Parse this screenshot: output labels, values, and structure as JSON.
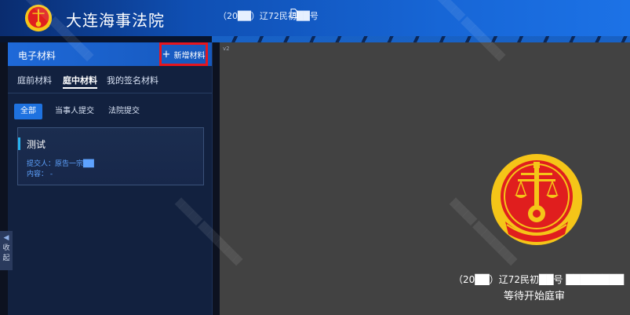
{
  "header": {
    "court_name": "大连海事法院",
    "case_no": "（20██）辽72民初██号"
  },
  "left_panel": {
    "title": "电子材料",
    "add_button": "新增材料",
    "tabs": [
      {
        "label": "庭前材料",
        "active": false
      },
      {
        "label": "庭中材料",
        "active": true
      },
      {
        "label": "我的签名材料",
        "active": false
      }
    ],
    "filters": [
      {
        "label": "全部",
        "active": true
      },
      {
        "label": "当事人提交",
        "active": false
      },
      {
        "label": "法院提交",
        "active": false
      }
    ],
    "card": {
      "name": "测试",
      "submitter": "提交人：原告一宗██",
      "content": "内容： -"
    },
    "collapse_label": "收起"
  },
  "video": {
    "version": "v2",
    "case_line": "（20██）辽72民初██号 ████████",
    "status": "等待开始庭审"
  },
  "colors": {
    "header_blue": "#1766d6",
    "panel_bg": "#12213f",
    "highlight": "#e6161e",
    "emblem_red": "#e01e1e",
    "emblem_gold": "#f5c518"
  }
}
